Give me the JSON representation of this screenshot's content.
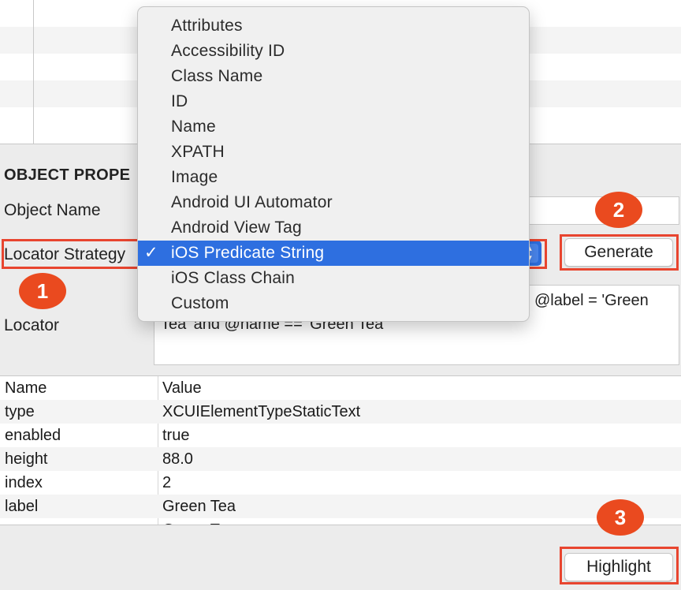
{
  "section": {
    "title": "OBJECT PROPE"
  },
  "labels": {
    "object_name": "Object Name",
    "locator_strategy": "Locator Strategy",
    "locator": "Locator"
  },
  "locator_strategy": {
    "selected": "iOS Predicate String",
    "options": [
      "Attributes",
      "Accessibility ID",
      "Class Name",
      "ID",
      "Name",
      "XPATH",
      "Image",
      "Android UI Automator",
      "Android View Tag",
      "iOS Predicate String",
      "iOS Class Chain",
      "Custom"
    ]
  },
  "locator_text": {
    "visible_line1": "@label = 'Green",
    "visible_line2": "Tea' and @name == 'Green Tea'"
  },
  "buttons": {
    "generate": "Generate",
    "highlight": "Highlight"
  },
  "properties": {
    "headers": {
      "name": "Name",
      "value": "Value"
    },
    "rows": [
      {
        "name": "type",
        "value": "XCUIElementTypeStaticText"
      },
      {
        "name": "enabled",
        "value": "true"
      },
      {
        "name": "height",
        "value": "88.0"
      },
      {
        "name": "index",
        "value": "2"
      },
      {
        "name": "label",
        "value": "Green Tea"
      },
      {
        "name": "name",
        "value": "Green Tea"
      }
    ]
  },
  "callouts": [
    "1",
    "2",
    "3"
  ],
  "colors": {
    "accent": "#2e6fe0",
    "callout": "#ea4a1f",
    "callout_border": "#e8452f"
  }
}
